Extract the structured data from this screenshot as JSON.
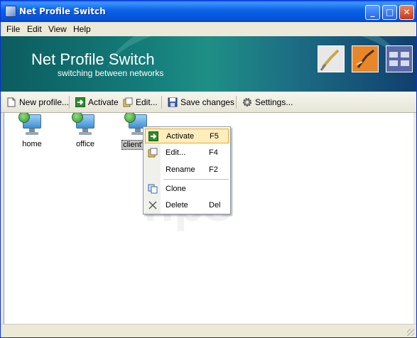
{
  "window": {
    "title": "Net Profile Switch"
  },
  "title_buttons": {
    "minimize": "_",
    "maximize": "□",
    "close": "✕"
  },
  "menu": [
    {
      "label": "File"
    },
    {
      "label": "Edit"
    },
    {
      "label": "View"
    },
    {
      "label": "Help"
    }
  ],
  "banner": {
    "title": "Net Profile Switch",
    "subtitle": "switching between networks"
  },
  "toolbar": {
    "new_profile": "New profile...",
    "activate": "Activate",
    "edit": "Edit...",
    "save_changes": "Save changes",
    "settings": "Settings..."
  },
  "profiles": [
    {
      "label": "home"
    },
    {
      "label": "office"
    },
    {
      "label": "client's s"
    }
  ],
  "context_menu": {
    "items": [
      {
        "label": "Activate",
        "shortcut": "F5"
      },
      {
        "label": "Edit...",
        "shortcut": "F4"
      },
      {
        "label": "Rename",
        "shortcut": "F2"
      },
      {
        "label": "Clone",
        "shortcut": ""
      },
      {
        "label": "Delete",
        "shortcut": "Del"
      }
    ]
  },
  "colors": {
    "accent_green": "#2f8f3a",
    "highlight": "#ffeebc",
    "titlebar": "#0a63e8"
  }
}
